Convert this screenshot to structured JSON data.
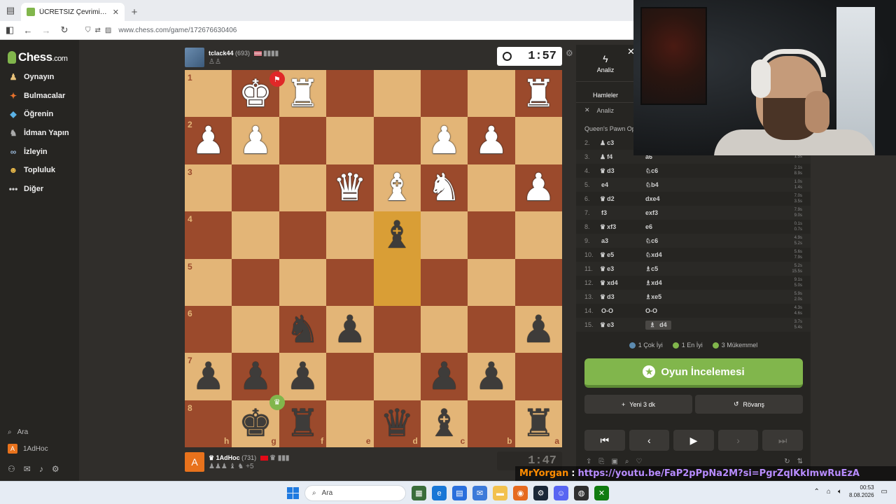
{
  "browser": {
    "tab_title": "ÜCRETSİZ Çevrimiçi Satranç Oy",
    "url": "www.chess.com/game/172676630406"
  },
  "sidebar": {
    "logo": "Chess",
    "logo_suffix": ".com",
    "items": [
      {
        "label": "Oynayın",
        "icon": "pawn-play-icon"
      },
      {
        "label": "Bulmacalar",
        "icon": "puzzle-icon"
      },
      {
        "label": "Öğrenin",
        "icon": "learn-cap-icon"
      },
      {
        "label": "İdman Yapın",
        "icon": "training-icon"
      },
      {
        "label": "İzleyin",
        "icon": "binoculars-icon"
      },
      {
        "label": "Topluluk",
        "icon": "community-icon"
      },
      {
        "label": "Diğer",
        "icon": "more-dots-icon"
      }
    ],
    "search_label": "Ara",
    "user_label": "1AdHoc",
    "user_avatar": "A"
  },
  "players": {
    "top": {
      "name": "tclack44",
      "rating": "(693)",
      "clock": "1:57",
      "flag": "US"
    },
    "bottom": {
      "name": "1AdHoc",
      "rating": "(731)",
      "clock": "1:47",
      "flag": "TR",
      "avatar": "A",
      "material_adv": "+5"
    }
  },
  "board": {
    "files": [
      "h",
      "g",
      "f",
      "e",
      "d",
      "c",
      "b",
      "a"
    ],
    "ranks": [
      "1",
      "2",
      "3",
      "4",
      "5",
      "6",
      "7",
      "8"
    ],
    "highlight_squares": [
      "d4",
      "d5"
    ],
    "pieces": [
      {
        "sq": "g1",
        "glyph": "♚",
        "color": "w",
        "badge": "flag-red"
      },
      {
        "sq": "f1",
        "glyph": "♜",
        "color": "w"
      },
      {
        "sq": "a1",
        "glyph": "♜",
        "color": "w"
      },
      {
        "sq": "h2",
        "glyph": "♟",
        "color": "w"
      },
      {
        "sq": "g2",
        "glyph": "♟",
        "color": "w"
      },
      {
        "sq": "c2",
        "glyph": "♟",
        "color": "w"
      },
      {
        "sq": "b2",
        "glyph": "♟",
        "color": "w"
      },
      {
        "sq": "e3",
        "glyph": "♛",
        "color": "w"
      },
      {
        "sq": "d3",
        "glyph": "♝",
        "color": "w"
      },
      {
        "sq": "c3",
        "glyph": "♞",
        "color": "w"
      },
      {
        "sq": "a3",
        "glyph": "♟",
        "color": "w"
      },
      {
        "sq": "d4",
        "glyph": "♝",
        "color": "b"
      },
      {
        "sq": "f6",
        "glyph": "♞",
        "color": "b"
      },
      {
        "sq": "e6",
        "glyph": "♟",
        "color": "b"
      },
      {
        "sq": "a6",
        "glyph": "♟",
        "color": "b"
      },
      {
        "sq": "h7",
        "glyph": "♟",
        "color": "b"
      },
      {
        "sq": "g7",
        "glyph": "♟",
        "color": "b"
      },
      {
        "sq": "f7",
        "glyph": "♟",
        "color": "b"
      },
      {
        "sq": "c7",
        "glyph": "♟",
        "color": "b"
      },
      {
        "sq": "b7",
        "glyph": "♟",
        "color": "b"
      },
      {
        "sq": "g8",
        "glyph": "♚",
        "color": "b",
        "badge": "crown-green"
      },
      {
        "sq": "f8",
        "glyph": "♜",
        "color": "b"
      },
      {
        "sq": "d8",
        "glyph": "♛",
        "color": "b"
      },
      {
        "sq": "c8",
        "glyph": "♝",
        "color": "b"
      },
      {
        "sq": "a8",
        "glyph": "♜",
        "color": "b"
      }
    ]
  },
  "panel": {
    "tab_analysis": "Analiz",
    "tab_moves": "Hamleler",
    "analysis_row": "Analiz",
    "opening": "Queen's Pawn Ope",
    "moves": [
      {
        "n": "2.",
        "w": "c3",
        "wpc": "♟",
        "b": "",
        "bpc": "",
        "t1": "",
        "t2": ""
      },
      {
        "n": "3.",
        "w": "f4",
        "wpc": "♟",
        "b": "a6",
        "bpc": "",
        "t1": "1.5s",
        "t2": ""
      },
      {
        "n": "4.",
        "w": "d3",
        "wpc": "♛",
        "b": "c6",
        "bpc": "♘",
        "t1": "2.1s",
        "t2": "8.9s"
      },
      {
        "n": "5.",
        "w": "e4",
        "wpc": "",
        "b": "b4",
        "bpc": "♘",
        "t1": "1.0s",
        "t2": "1.4s"
      },
      {
        "n": "6.",
        "w": "d2",
        "wpc": "♛",
        "b": "dxe4",
        "bpc": "",
        "t1": "7.0s",
        "t2": "3.5s"
      },
      {
        "n": "7.",
        "w": "f3",
        "wpc": "",
        "b": "exf3",
        "bpc": "",
        "t1": "7.9s",
        "t2": "9.0s"
      },
      {
        "n": "8.",
        "w": "xf3",
        "wpc": "♛",
        "b": "e6",
        "bpc": "",
        "t1": "0.1s",
        "t2": "0.7s"
      },
      {
        "n": "9.",
        "w": "a3",
        "wpc": "",
        "b": "c6",
        "bpc": "♘",
        "t1": "4.9s",
        "t2": "5.2s"
      },
      {
        "n": "10.",
        "w": "e5",
        "wpc": "♛",
        "b": "xd4",
        "bpc": "♘",
        "t1": "5.6s",
        "t2": "7.9s"
      },
      {
        "n": "11.",
        "w": "e3",
        "wpc": "♛",
        "b": "c5",
        "bpc": "♗",
        "t1": "5.2s",
        "t2": "15.5s"
      },
      {
        "n": "12.",
        "w": "xd4",
        "wpc": "♛",
        "b": "xd4",
        "bpc": "♗",
        "t1": "9.1s",
        "t2": "5.0s"
      },
      {
        "n": "13.",
        "w": "d3",
        "wpc": "♛",
        "b": "xe5",
        "bpc": "♗",
        "t1": "5.9s",
        "t2": "2.0s"
      },
      {
        "n": "14.",
        "w": "O-O",
        "wpc": "",
        "b": "O-O",
        "bpc": "",
        "t1": "4.3s",
        "t2": "4.6s"
      },
      {
        "n": "15.",
        "w": "e3",
        "wpc": "♛",
        "b": "d4",
        "bpc": "♗",
        "t1": "3.7s",
        "t2": "5.4s"
      }
    ],
    "summary": [
      {
        "label": "1 Çok İyi",
        "color": "#5c8bb0"
      },
      {
        "label": "1 En İyi",
        "color": "#81b64c"
      },
      {
        "label": "3 Mükemmel",
        "color": "#81b64c"
      }
    ],
    "review_label": "Oyun İncelemesi",
    "new_game_label": "Yeni 3 dk",
    "rematch_label": "Rövanş"
  },
  "overlay": {
    "user": "MrYorgan",
    "separator": ":",
    "url": "https://youtu.be/FaP2pPpNa2M?si=PgrZqlKkImwRuEzA"
  },
  "taskbar": {
    "search_label": "Ara",
    "time": "00:53",
    "date": "8.08.2026"
  }
}
